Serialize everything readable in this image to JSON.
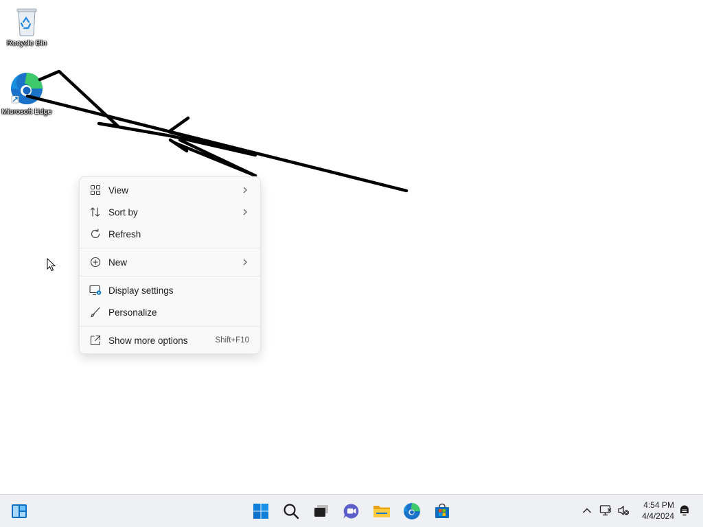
{
  "desktop": {
    "icons": [
      {
        "label": "Recycle Bin",
        "icon": "recycle-bin-icon"
      },
      {
        "label": "Microsoft Edge",
        "icon": "edge-icon"
      }
    ]
  },
  "context_menu": {
    "items": [
      {
        "label": "View",
        "icon": "grid-icon",
        "submenu": true
      },
      {
        "label": "Sort by",
        "icon": "sort-icon",
        "submenu": true
      },
      {
        "label": "Refresh",
        "icon": "refresh-icon"
      },
      {
        "label": "New",
        "icon": "plus-circle-icon",
        "submenu": true
      },
      {
        "label": "Display settings",
        "icon": "display-settings-icon"
      },
      {
        "label": "Personalize",
        "icon": "brush-icon"
      },
      {
        "label": "Show more options",
        "icon": "share-icon",
        "shortcut": "Shift+F10"
      }
    ]
  },
  "taskbar": {
    "widgets_icon": "widgets-icon",
    "apps": [
      {
        "name": "Start",
        "icon": "windows-start-icon"
      },
      {
        "name": "Search",
        "icon": "search-icon"
      },
      {
        "name": "Task View",
        "icon": "task-view-icon"
      },
      {
        "name": "Chat",
        "icon": "chat-icon"
      },
      {
        "name": "File Explorer",
        "icon": "folder-icon"
      },
      {
        "name": "Microsoft Edge",
        "icon": "edge-icon"
      },
      {
        "name": "Microsoft Store",
        "icon": "store-icon"
      }
    ],
    "tray": {
      "icons": [
        "chevron-up-icon",
        "network-icon",
        "volume-muted-icon",
        "notification-icon"
      ],
      "time": "4:54 PM",
      "date": "4/4/2024"
    }
  },
  "colors": {
    "accent": "#0078d4",
    "menu_bg": "#f9f9f9",
    "taskbar_bg": "#eef0f3"
  }
}
